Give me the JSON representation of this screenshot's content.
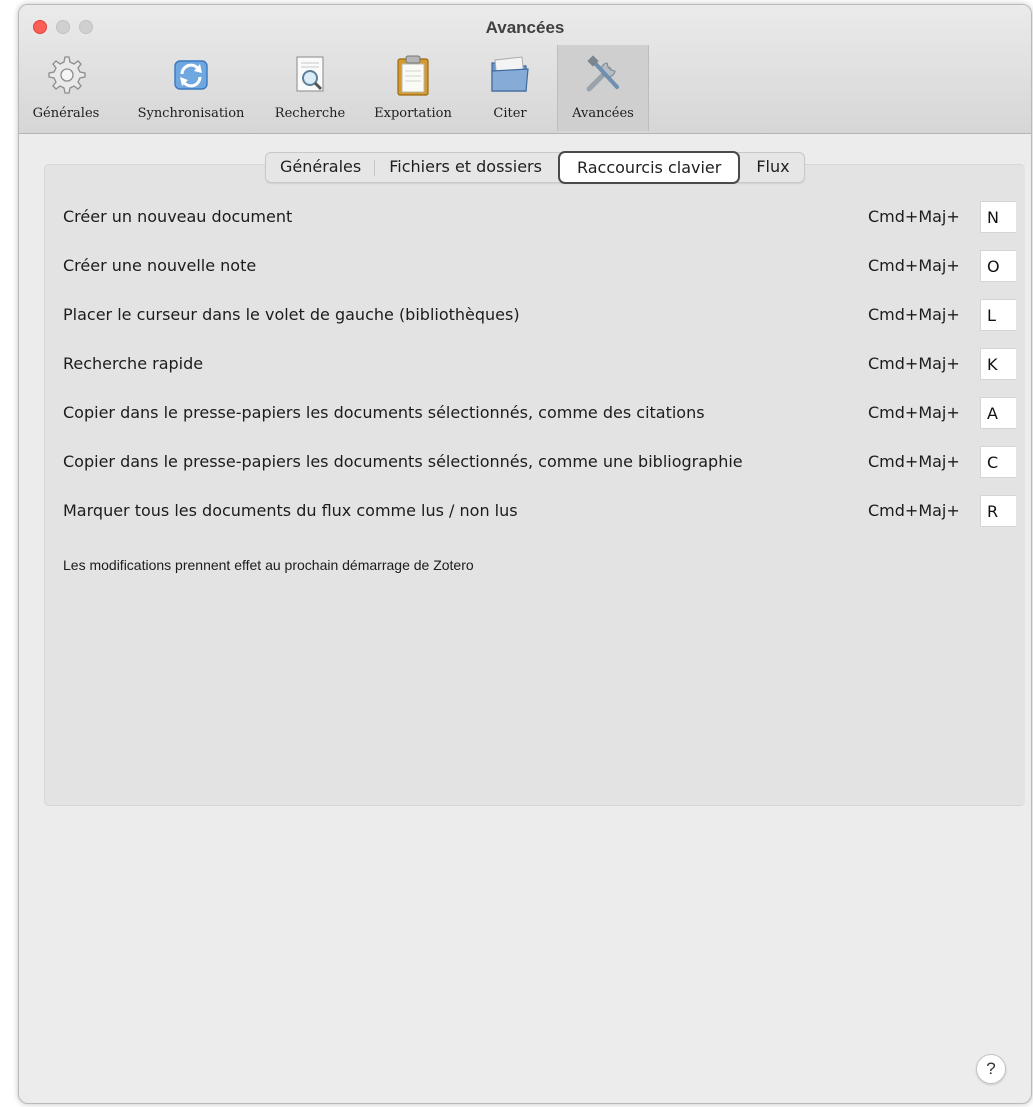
{
  "window": {
    "title": "Avancées"
  },
  "toolbar": {
    "items": [
      {
        "label": "Générales",
        "icon": "gear-icon"
      },
      {
        "label": "Synchronisation",
        "icon": "sync-icon"
      },
      {
        "label": "Recherche",
        "icon": "search-document-icon"
      },
      {
        "label": "Exportation",
        "icon": "clipboard-icon"
      },
      {
        "label": "Citer",
        "icon": "folder-icon"
      },
      {
        "label": "Avancées",
        "icon": "tools-icon",
        "selected": true
      }
    ]
  },
  "tabs": [
    {
      "label": "Générales"
    },
    {
      "label": "Fichiers et dossiers"
    },
    {
      "label": "Raccourcis clavier",
      "active": true
    },
    {
      "label": "Flux"
    }
  ],
  "shortcuts": [
    {
      "label": "Créer un nouveau document",
      "modifier": "Cmd+Maj+",
      "key": "N"
    },
    {
      "label": "Créer une nouvelle note",
      "modifier": "Cmd+Maj+",
      "key": "O"
    },
    {
      "label": "Placer le curseur dans le volet de gauche (bibliothèques)",
      "modifier": "Cmd+Maj+",
      "key": "L"
    },
    {
      "label": "Recherche rapide",
      "modifier": "Cmd+Maj+",
      "key": "K"
    },
    {
      "label": "Copier dans le presse-papiers les documents sélectionnés, comme des citations",
      "modifier": "Cmd+Maj+",
      "key": "A"
    },
    {
      "label": "Copier dans le presse-papiers les documents sélectionnés, comme une bibliographie",
      "modifier": "Cmd+Maj+",
      "key": "C"
    },
    {
      "label": "Marquer tous les documents du flux comme lus / non lus",
      "modifier": "Cmd+Maj+",
      "key": "R"
    }
  ],
  "note": "Les modifications prennent effet au prochain démarrage de Zotero",
  "help": {
    "label": "?"
  },
  "colors": {
    "close_button": "#fc5f57",
    "window_bg": "#ececec",
    "active_tab_border": "#4a4a4a"
  }
}
